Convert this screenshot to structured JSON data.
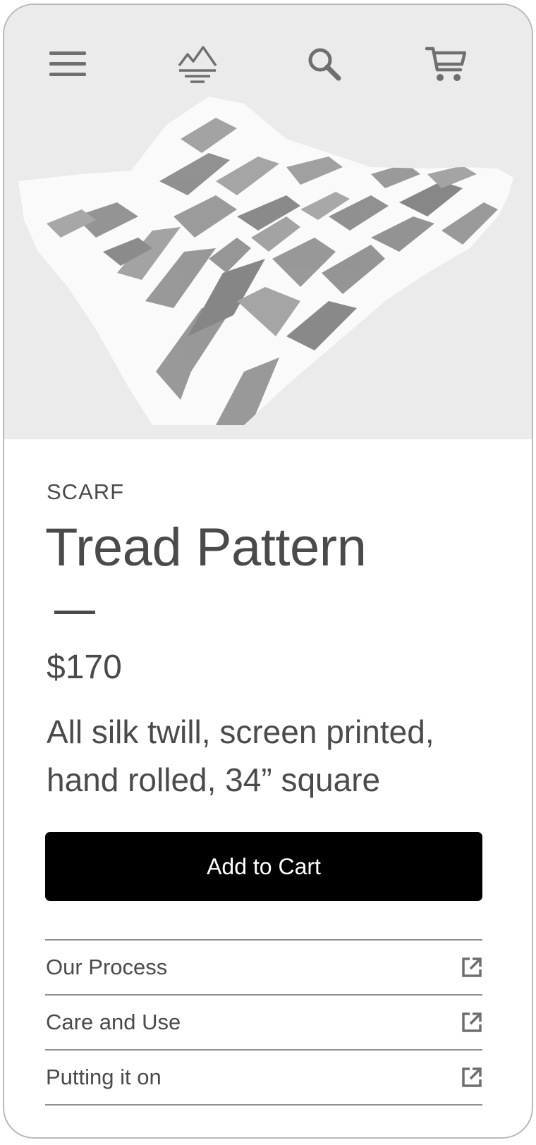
{
  "header": {
    "menu_icon": "hamburger-menu-icon",
    "logo_icon": "mountain-logo-icon",
    "search_icon": "search-icon",
    "cart_icon": "shopping-cart-icon"
  },
  "hero": {
    "image": "patterned-silk-scarf-photo"
  },
  "product": {
    "category": "SCARF",
    "title": "Tread Pattern",
    "price": "$170",
    "description": "All silk twill, screen printed, hand rolled, 34” square",
    "add_to_cart_label": "Add to Cart"
  },
  "links": [
    {
      "label": "Our Process",
      "icon": "external-link-icon"
    },
    {
      "label": "Care and Use",
      "icon": "external-link-icon"
    },
    {
      "label": "Putting it on",
      "icon": "external-link-icon"
    }
  ],
  "colors": {
    "hero_background": "#ebebeb",
    "text": "#4a4a4a",
    "button_background": "#000000",
    "button_text": "#ffffff",
    "divider": "#8f8f8f"
  }
}
